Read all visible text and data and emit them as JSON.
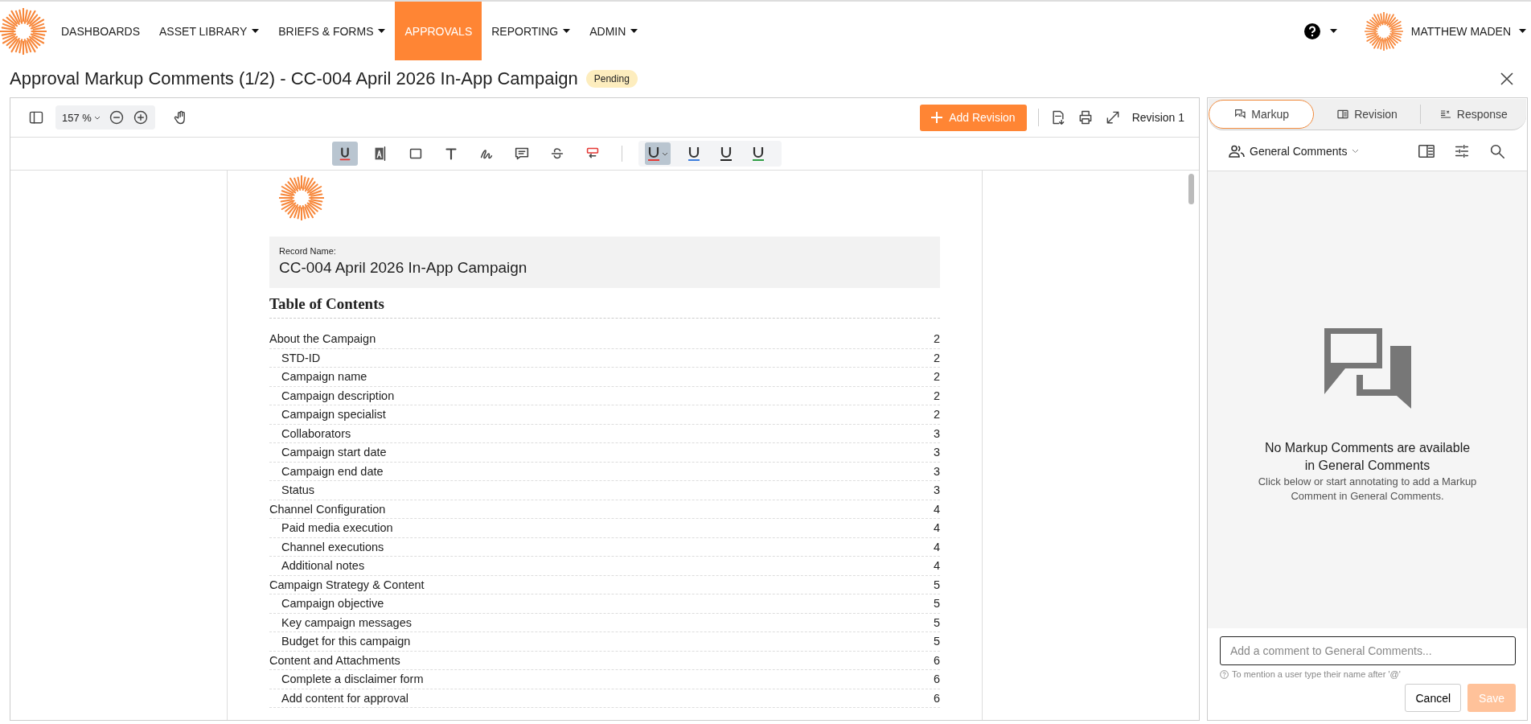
{
  "nav": {
    "items": [
      {
        "label": "DASHBOARDS",
        "selected": false,
        "dropdown": false
      },
      {
        "label": "ASSET LIBRARY",
        "selected": false,
        "dropdown": true
      },
      {
        "label": "BRIEFS & FORMS",
        "selected": false,
        "dropdown": true
      },
      {
        "label": "APPROVALS",
        "selected": true,
        "dropdown": false
      },
      {
        "label": "REPORTING",
        "selected": false,
        "dropdown": true
      },
      {
        "label": "ADMIN",
        "selected": false,
        "dropdown": true
      }
    ],
    "user": "MATTHEW MADEN"
  },
  "page_title": "Approval Markup Comments (1/2) - CC-004 April 2026 In-App Campaign",
  "status": "Pending",
  "viewer": {
    "zoom": "157 %",
    "add_button": "Add Revision",
    "revision": "Revision 1",
    "tools": [
      {
        "kind": "underline",
        "selected": true
      },
      {
        "kind": "highlight",
        "selected": false
      },
      {
        "kind": "rectangle",
        "selected": false
      },
      {
        "kind": "text",
        "selected": false
      },
      {
        "kind": "freehand",
        "selected": false
      },
      {
        "kind": "comment",
        "selected": false
      },
      {
        "kind": "strikeout",
        "selected": false
      },
      {
        "kind": "replace",
        "selected": false
      }
    ],
    "colors": [
      {
        "color": "#e53935",
        "selected": true
      },
      {
        "color": "#3b7ddd",
        "selected": false
      },
      {
        "color": "#222222",
        "selected": false
      },
      {
        "color": "#2e9e44",
        "selected": false
      }
    ]
  },
  "document": {
    "record_label": "Record Name:",
    "record_name": "CC-004 April 2026 In-App Campaign",
    "toc_title": "Table of Contents",
    "toc": [
      {
        "title": "About the Campaign",
        "page": "2",
        "children": [
          {
            "title": "STD-ID",
            "page": "2"
          },
          {
            "title": "Campaign name",
            "page": "2"
          },
          {
            "title": "Campaign description",
            "page": "2"
          },
          {
            "title": "Campaign specialist",
            "page": "2"
          },
          {
            "title": "Collaborators",
            "page": "3"
          },
          {
            "title": "Campaign start date",
            "page": "3"
          },
          {
            "title": "Campaign end date",
            "page": "3"
          },
          {
            "title": "Status",
            "page": "3"
          }
        ]
      },
      {
        "title": "Channel Configuration",
        "page": "4",
        "children": [
          {
            "title": "Paid media execution",
            "page": "4"
          },
          {
            "title": "Channel executions",
            "page": "4"
          },
          {
            "title": "Additional notes",
            "page": "4"
          }
        ]
      },
      {
        "title": "Campaign Strategy & Content",
        "page": "5",
        "children": [
          {
            "title": "Campaign objective",
            "page": "5"
          },
          {
            "title": "Key campaign messages",
            "page": "5"
          },
          {
            "title": "Budget for this campaign",
            "page": "5"
          }
        ]
      },
      {
        "title": "Content and Attachments",
        "page": "6",
        "children": [
          {
            "title": "Complete a disclaimer form",
            "page": "6"
          },
          {
            "title": "Add content for approval",
            "page": "6"
          }
        ]
      }
    ]
  },
  "panel": {
    "tabs": [
      {
        "label": "Markup",
        "selected": true,
        "kind": "markup"
      },
      {
        "label": "Revision",
        "selected": false,
        "kind": "revision"
      },
      {
        "label": "Response",
        "selected": false,
        "kind": "response"
      }
    ],
    "filter": "General Comments",
    "empty_title": "No Markup Comments are available in General Comments",
    "empty_text": "Click below or start annotating to add a Markup Comment in General Comments.",
    "comment_placeholder": "Add a comment to General Comments...",
    "hint": "To mention a user type their name after '@'",
    "cancel": "Cancel",
    "save": "Save"
  }
}
